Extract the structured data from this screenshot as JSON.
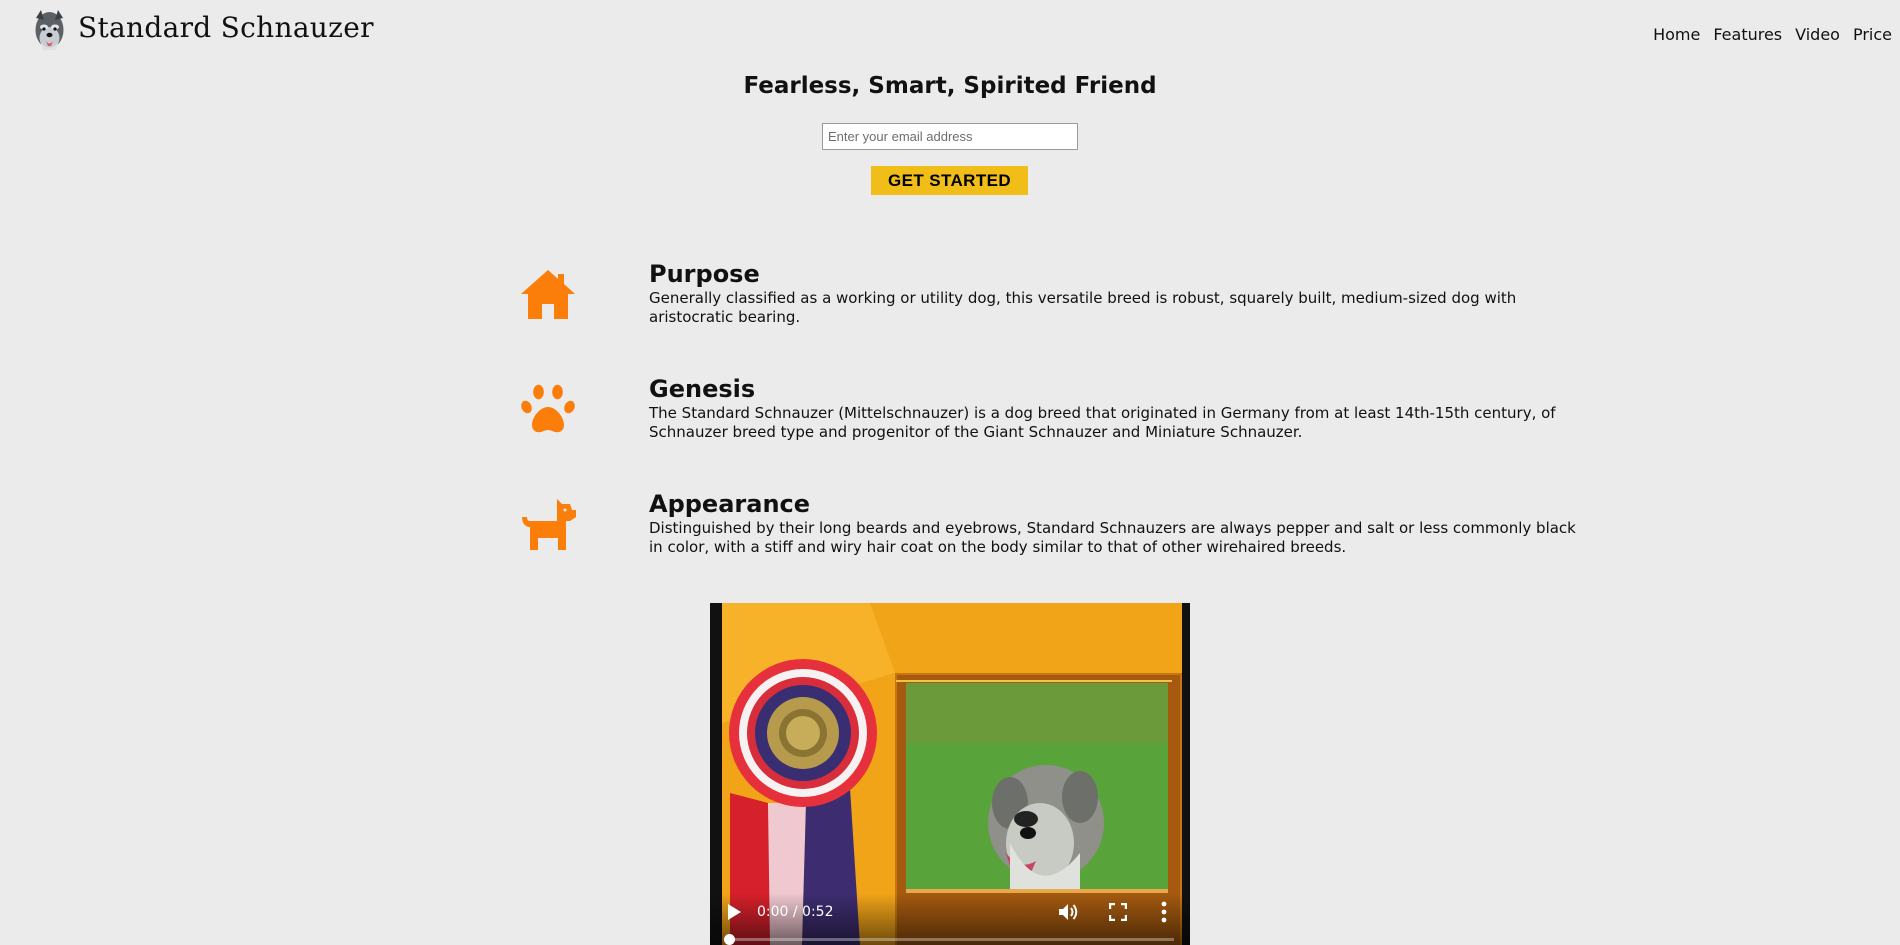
{
  "header": {
    "brand": "Standard Schnauzer",
    "nav": [
      {
        "label": "Home"
      },
      {
        "label": "Features"
      },
      {
        "label": "Video"
      },
      {
        "label": "Price"
      }
    ]
  },
  "hero": {
    "title": "Fearless, Smart, Spirited Friend",
    "email_placeholder": "Enter your email address",
    "cta_label": "GET STARTED"
  },
  "features": [
    {
      "icon": "house-icon",
      "title": "Purpose",
      "text": "Generally classified as a working or utility dog, this versatile breed is robust, squarely built, medium-sized dog with aristocratic bearing."
    },
    {
      "icon": "paw-icon",
      "title": "Genesis",
      "text": "The Standard Schnauzer (Mittelschnauzer) is a dog breed that originated in Germany from at least 14th-15th century, of Schnauzer breed type and progenitor of the Giant Schnauzer and Miniature Schnauzer."
    },
    {
      "icon": "dog-icon",
      "title": "Appearance",
      "text": "Distinguished by their long beards and eyebrows, Standard Schnauzers are always pepper and salt or less commonly black in color, with a stiff and wiry hair coat on the body similar to that of other wirehaired breeds."
    }
  ],
  "video": {
    "time": "0:00 / 0:52",
    "progress": 0
  },
  "colors": {
    "background": "#ebebeb",
    "accent_orange": "#fb7d0a",
    "cta_yellow": "#f1be19"
  }
}
